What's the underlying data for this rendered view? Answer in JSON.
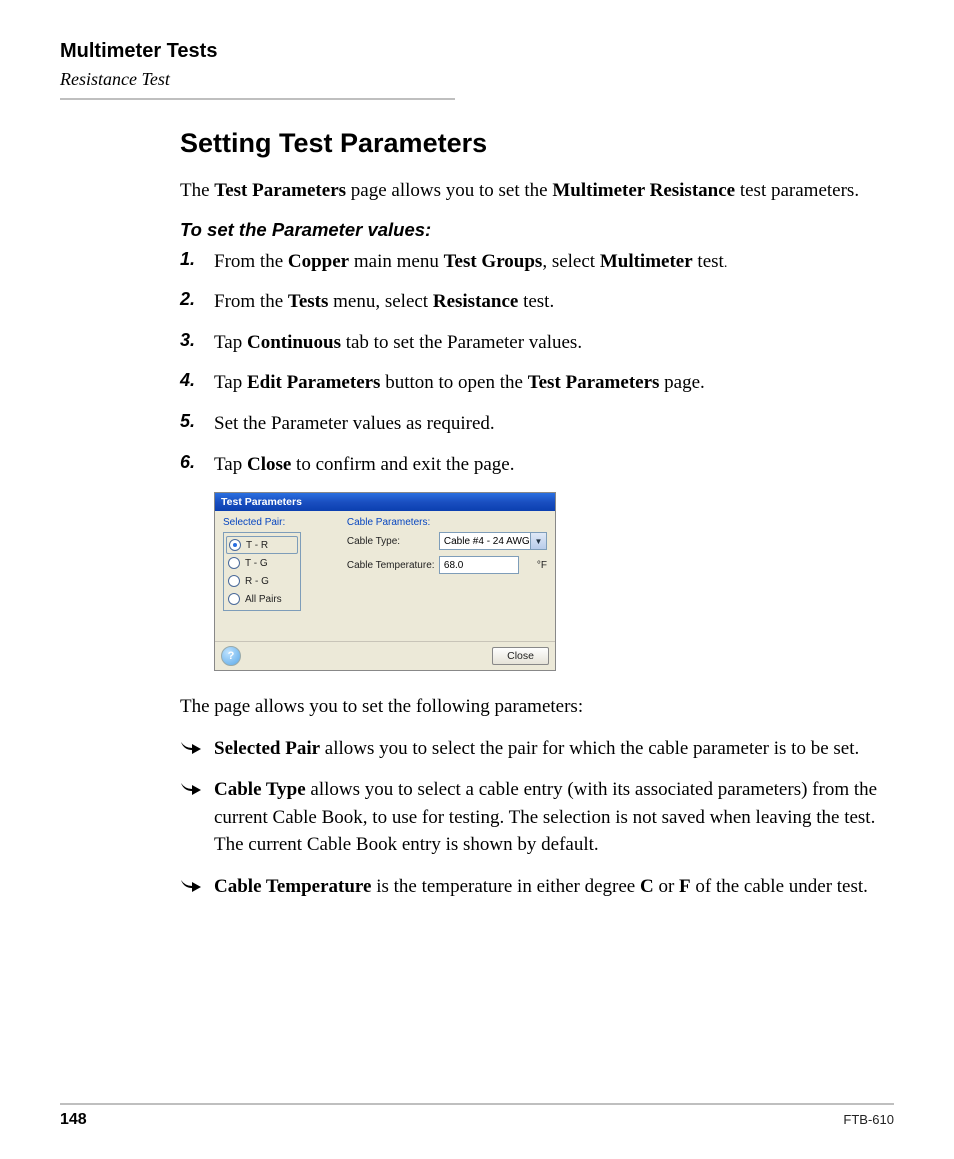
{
  "header": {
    "chapter": "Multimeter Tests",
    "section": "Resistance Test"
  },
  "heading": "Setting Test Parameters",
  "intro": {
    "pre": "The ",
    "b1": "Test Parameters",
    "mid": " page allows you to set the ",
    "b2": "Multimeter Resistance",
    "post": " test parameters."
  },
  "subhead": "To set the Parameter values:",
  "steps": [
    {
      "num": "1.",
      "parts": [
        "From the ",
        "Copper",
        " main menu ",
        "Test Groups",
        ", select ",
        "Multimeter",
        " test",
        "."
      ]
    },
    {
      "num": "2.",
      "parts": [
        "From the ",
        "Tests",
        " menu, select ",
        "Resistance",
        " test."
      ]
    },
    {
      "num": "3.",
      "parts": [
        "Tap ",
        "Continuous",
        " tab to set the Parameter values."
      ]
    },
    {
      "num": "4.",
      "parts": [
        "Tap ",
        "Edit Parameters",
        " button to open the ",
        "Test Parameters",
        " page."
      ]
    },
    {
      "num": "5.",
      "parts": [
        "Set the Parameter values as required."
      ]
    },
    {
      "num": "6.",
      "parts": [
        "Tap ",
        "Close",
        " to confirm and exit the page."
      ]
    }
  ],
  "dialog": {
    "title": "Test Parameters",
    "selectedPairLabel": "Selected Pair:",
    "pairs": [
      "T - R",
      "T - G",
      "R - G",
      "All Pairs"
    ],
    "selectedIndex": 0,
    "cableParamsLabel": "Cable Parameters:",
    "cableTypeLabel": "Cable Type:",
    "cableTypeValue": "Cable #4 - 24 AWG",
    "cableTempLabel": "Cable Temperature:",
    "cableTempValue": "68.0",
    "cableTempUnit": "°F",
    "help": "?",
    "closeLabel": "Close"
  },
  "after": "The page allows you to set the following parameters:",
  "bullets": [
    {
      "b": "Selected Pair",
      "rest": " allows you to select the pair for which the cable parameter is to be set."
    },
    {
      "b": "Cable Type",
      "rest": " allows you to select a cable entry (with its associated parameters) from the current Cable Book, to use for testing. The selection is not saved when leaving the test. The current Cable Book entry is shown by default."
    },
    {
      "b": "Cable Temperature",
      "rest": " is the temperature in either degree ",
      "b2": "C",
      "mid": " or ",
      "b3": "F",
      "rest2": " of the cable under test."
    }
  ],
  "footer": {
    "page": "148",
    "docid": "FTB-610"
  }
}
